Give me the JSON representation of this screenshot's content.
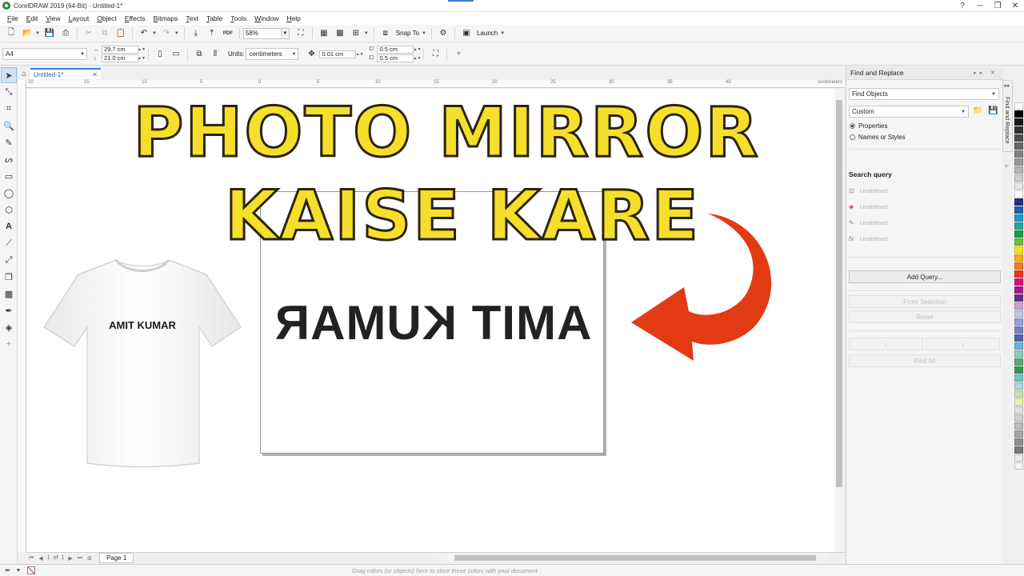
{
  "window": {
    "title": "CorelDRAW 2019 (64-Bit) - Untitled-1*",
    "controls": [
      "?",
      "─",
      "❐",
      "✕"
    ]
  },
  "menu": [
    "File",
    "Edit",
    "View",
    "Layout",
    "Object",
    "Effects",
    "Bitmaps",
    "Text",
    "Table",
    "Tools",
    "Window",
    "Help"
  ],
  "toolbar": {
    "zoom": "58%",
    "snap_label": "Snap To",
    "launch_label": "Launch",
    "pdf_label": "PDF"
  },
  "propbar": {
    "page_size": "A4",
    "width": "29.7 cm",
    "height": "21.0 cm",
    "units_label": "Units:",
    "units_value": "centimeters",
    "nudge": "0.01 cm",
    "dup_x": "0.5 cm",
    "dup_y": "0.5 cm",
    "add_label": "+"
  },
  "doc_tab": {
    "label": "Untitled-1*",
    "close": "✕"
  },
  "ruler": {
    "top_numbers": [
      "10",
      "15",
      "10",
      "5",
      "0",
      "5",
      "10",
      "15",
      "20",
      "25",
      "30",
      "35",
      "40"
    ],
    "unit": "centimeters"
  },
  "canvas": {
    "headline_line1": "PHOTO MIRROR",
    "headline_line2": "KAISE KARE",
    "mirrored_text": "AMIT KUMAR",
    "tshirt_text": "AMIT KUMAR",
    "colors": {
      "headline_fill": "#f5df2a",
      "headline_stroke": "#2a2410",
      "arrow": "#e23a12"
    }
  },
  "page_nav": {
    "current": "1",
    "of_label": "of",
    "total": "1",
    "page_tab": "Page 1"
  },
  "status": {
    "hint": "Drag colors (or objects) here to store these colors with your document"
  },
  "docker": {
    "title": "Find and Replace",
    "mode": "Find Objects",
    "preset": "Custom",
    "radio_properties": "Properties",
    "radio_names": "Names or Styles",
    "search_query_heading": "Search query",
    "query_rows": [
      "Undefined",
      "Undefined",
      "Undefined",
      "Undefined"
    ],
    "add_query": "Add Query...",
    "from_selection": "From Selection",
    "reset": "Reset",
    "prev": "‹",
    "next": "›",
    "find_all": "Find All",
    "side_tab": "Find and Replace"
  },
  "palette": [
    "#ffffff",
    "#000000",
    "#1a1a1a",
    "#333333",
    "#4d4d4d",
    "#666666",
    "#808080",
    "#999999",
    "#b3b3b3",
    "#cccccc",
    "#e6e6e6",
    "#ffffff",
    "#2b2d82",
    "#1f5fa8",
    "#1f99c4",
    "#23a69b",
    "#1c9a49",
    "#74b843",
    "#f0e51e",
    "#f7ad1f",
    "#ee7d22",
    "#e53421",
    "#d8127d",
    "#a61d87",
    "#6a2b86",
    "#c9a1cf",
    "#bfc6e6",
    "#9aa4d4",
    "#7481c2",
    "#5261ad",
    "#6fb0d8",
    "#8ccbb8",
    "#5fa67a",
    "#3f8f5d",
    "#76c4c0",
    "#a8d9d3",
    "#c4e3b0",
    "#e7f1b4",
    "#e0e0e0",
    "#d0d0d0",
    "#bcbcbc",
    "#a6a6a6",
    "#8f8f8f",
    "#787878",
    "#e8e8e8",
    "#f4f4f4"
  ]
}
